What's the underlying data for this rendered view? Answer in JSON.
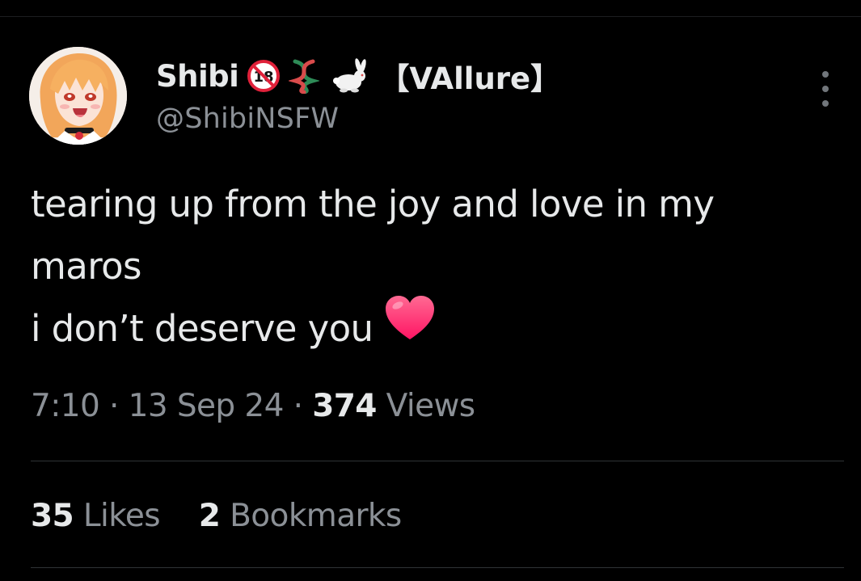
{
  "tweet": {
    "author": {
      "display_name": "Shibi",
      "name_badges": [
        "no-under-18-icon",
        "knot-icon",
        "rabbit-icon"
      ],
      "name_suffix": "【VAllure】",
      "handle": "@ShibiNSFW"
    },
    "text_lines": [
      "tearing up from the joy and love in my",
      "maros",
      "i don’t deserve you"
    ],
    "trailing_emoji": "heart-icon",
    "time": "7:10",
    "separator": "·",
    "date": "13 Sep 24",
    "views_count": "374",
    "views_label": "Views",
    "likes_count": "35",
    "likes_label": "Likes",
    "bookmarks_count": "2",
    "bookmarks_label": "Bookmarks"
  },
  "colors": {
    "background": "#000000",
    "primary_text": "#e7e9ea",
    "secondary_text": "#8b9096",
    "divider": "#2f3336",
    "heart": "#ff2d6f"
  }
}
